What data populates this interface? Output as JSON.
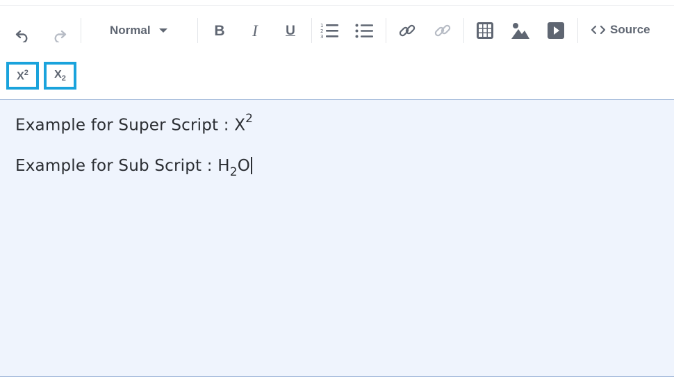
{
  "toolbar": {
    "paragraph_style": "Normal",
    "source_label": "Source",
    "buttons": [
      {
        "name": "undo",
        "enabled": true
      },
      {
        "name": "redo",
        "enabled": false
      },
      {
        "name": "bold",
        "label": "B"
      },
      {
        "name": "italic",
        "label": "I"
      },
      {
        "name": "underline",
        "label": "U"
      },
      {
        "name": "numbered-list"
      },
      {
        "name": "bulleted-list"
      },
      {
        "name": "link",
        "enabled": true
      },
      {
        "name": "unlink",
        "enabled": false
      },
      {
        "name": "table"
      },
      {
        "name": "image"
      },
      {
        "name": "video"
      }
    ],
    "superscript": {
      "base": "X",
      "script": "2"
    },
    "subscript": {
      "base": "X",
      "script": "2"
    }
  },
  "editor": {
    "line1": {
      "text": "Example for Super Script : X",
      "sup": "2"
    },
    "line2": {
      "text": "Example for Sub Script : H",
      "sub": "2",
      "tail": "O"
    }
  }
}
